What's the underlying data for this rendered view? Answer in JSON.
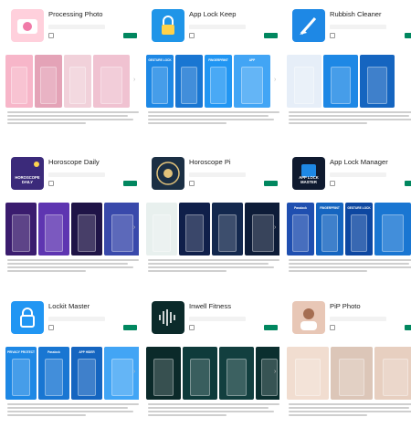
{
  "apps": [
    {
      "title": "Processing Photo",
      "dev": "",
      "cat": "",
      "wishlist": "",
      "install": "",
      "accent": "#f07aa8",
      "icon": "camera-icon",
      "shots": [
        "",
        "",
        "",
        ""
      ]
    },
    {
      "title": "App Lock Keep",
      "dev": "",
      "cat": "",
      "wishlist": "",
      "install": "",
      "accent": "#1f95e8",
      "icon": "lock-icon",
      "shots": [
        "GESTURE LOCK",
        "",
        "FINGERPRINT",
        "APP"
      ]
    },
    {
      "title": "Rubbish Cleaner",
      "dev": "",
      "cat": "",
      "wishlist": "",
      "install": "",
      "accent": "#1e88e5",
      "icon": "broom-icon",
      "shots": [
        "",
        "",
        "",
        ""
      ]
    },
    {
      "title": "Horoscope Daily",
      "dev": "",
      "cat": "",
      "wishlist": "",
      "install": "",
      "accent": "#7b57c9",
      "icon": "horoscope-daily-icon",
      "icon_text": "HOROSCOPE DAILY",
      "shots": [
        "",
        "",
        "",
        ""
      ]
    },
    {
      "title": "Horoscope Pi",
      "dev": "",
      "cat": "",
      "wishlist": "",
      "install": "",
      "accent": "#1b2f44",
      "icon": "zodiac-wheel-icon",
      "shots": [
        "",
        "",
        "",
        ""
      ]
    },
    {
      "title": "App Lock Manager",
      "dev": "",
      "cat": "",
      "wishlist": "",
      "install": "",
      "accent": "#1f4fb0",
      "icon": "app-lock-master-icon",
      "icon_text": "APP LOCK MASTER",
      "shots": [
        "Passlock",
        "FINGERPRINT",
        "GESTURE LOCK",
        ""
      ]
    },
    {
      "title": "Lockit Master",
      "dev": "",
      "cat": "",
      "wishlist": "",
      "install": "",
      "accent": "#2196f3",
      "icon": "padlock-icon",
      "shots": [
        "PRIVACY PROTECT",
        "Passlock",
        "APP HIDER",
        ""
      ]
    },
    {
      "title": "Inwell Fitness",
      "dev": "",
      "cat": "",
      "wishlist": "",
      "install": "",
      "accent": "#0b2a2a",
      "icon": "sound-wave-icon",
      "shots": [
        "",
        "",
        "",
        ""
      ]
    },
    {
      "title": "PiP Photo",
      "dev": "",
      "cat": "",
      "wishlist": "",
      "install": "",
      "accent": "#e8c7b6",
      "icon": "portrait-icon",
      "shots": [
        "",
        "",
        ""
      ]
    }
  ],
  "colors": {
    "install_green": "#01875f",
    "title_text": "#222222"
  }
}
